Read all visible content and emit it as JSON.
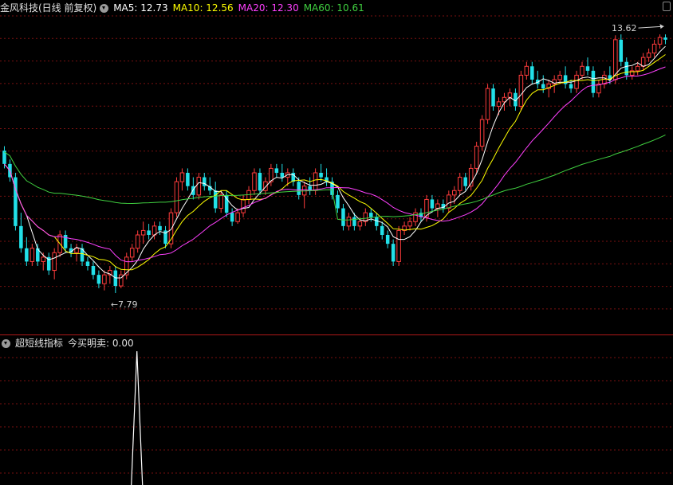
{
  "header": {
    "stock_label": "金风科技(日线 前复权)",
    "ma5": {
      "label": "MA5: 12.73",
      "color": "#ffffff"
    },
    "ma10": {
      "label": "MA10: 12.56",
      "color": "#ffff00"
    },
    "ma20": {
      "label": "MA20: 12.30",
      "color": "#ff40ff"
    },
    "ma60": {
      "label": "MA60: 10.61",
      "color": "#40d040"
    }
  },
  "sub_header": {
    "indicator_label": "超短线指标",
    "value_label": "今买明卖: 0.00"
  },
  "colors": {
    "up": "#ff3c3c",
    "down": "#22e0e8",
    "grid": "#7a1010"
  },
  "chart_data": [
    {
      "type": "candlestick",
      "title": "金风科技(日线 前复权)",
      "ylim": [
        7.0,
        14.0
      ],
      "grid": true,
      "annotations": [
        {
          "text": "13.62",
          "price": 13.62,
          "index": 119
        },
        {
          "text": "←7.79",
          "price": 7.79,
          "index": 20
        }
      ],
      "candles": [
        [
          11.0,
          11.1,
          10.6,
          10.7
        ],
        [
          10.7,
          10.8,
          10.3,
          10.4
        ],
        [
          10.4,
          10.5,
          9.2,
          9.3
        ],
        [
          9.3,
          9.6,
          8.7,
          8.8
        ],
        [
          8.8,
          9.05,
          8.4,
          8.5
        ],
        [
          8.5,
          8.9,
          8.4,
          8.8
        ],
        [
          8.8,
          8.9,
          8.4,
          8.5
        ],
        [
          8.5,
          8.7,
          8.3,
          8.6
        ],
        [
          8.6,
          8.7,
          8.2,
          8.3
        ],
        [
          8.3,
          8.8,
          8.1,
          8.7
        ],
        [
          8.7,
          9.2,
          8.6,
          9.1
        ],
        [
          9.1,
          9.2,
          8.7,
          8.8
        ],
        [
          8.8,
          8.9,
          8.6,
          8.7
        ],
        [
          8.7,
          8.9,
          8.5,
          8.8
        ],
        [
          8.8,
          8.9,
          8.4,
          8.5
        ],
        [
          8.5,
          8.6,
          8.3,
          8.4
        ],
        [
          8.4,
          8.5,
          8.1,
          8.2
        ],
        [
          8.2,
          8.3,
          7.9,
          8.0
        ],
        [
          8.0,
          8.3,
          7.85,
          8.2
        ],
        [
          8.2,
          8.4,
          8.0,
          8.3
        ],
        [
          8.3,
          8.4,
          7.79,
          7.95
        ],
        [
          7.95,
          8.3,
          7.9,
          8.2
        ],
        [
          8.2,
          8.7,
          8.1,
          8.6
        ],
        [
          8.6,
          8.9,
          8.5,
          8.8
        ],
        [
          8.8,
          9.2,
          8.7,
          9.1
        ],
        [
          9.1,
          9.4,
          8.9,
          9.2
        ],
        [
          9.2,
          9.35,
          9.0,
          9.1
        ],
        [
          9.1,
          9.4,
          9.0,
          9.3
        ],
        [
          9.3,
          9.4,
          9.1,
          9.2
        ],
        [
          9.2,
          9.3,
          8.8,
          8.9
        ],
        [
          8.9,
          9.7,
          8.8,
          9.6
        ],
        [
          9.6,
          10.4,
          9.5,
          10.3
        ],
        [
          10.3,
          10.6,
          10.1,
          10.5
        ],
        [
          10.5,
          10.6,
          10.1,
          10.2
        ],
        [
          10.2,
          10.4,
          9.9,
          10.0
        ],
        [
          10.0,
          10.5,
          9.9,
          10.4
        ],
        [
          10.4,
          10.5,
          10.1,
          10.2
        ],
        [
          10.2,
          10.4,
          10.0,
          10.1
        ],
        [
          10.1,
          10.3,
          9.6,
          9.7
        ],
        [
          9.7,
          10.1,
          9.6,
          10.0
        ],
        [
          10.0,
          10.1,
          9.5,
          9.6
        ],
        [
          9.6,
          9.7,
          9.3,
          9.4
        ],
        [
          9.4,
          9.7,
          9.35,
          9.6
        ],
        [
          9.6,
          10.0,
          9.5,
          9.9
        ],
        [
          9.9,
          10.2,
          9.8,
          10.1
        ],
        [
          10.1,
          10.6,
          10.0,
          10.5
        ],
        [
          10.5,
          10.6,
          10.0,
          10.1
        ],
        [
          10.1,
          10.4,
          10.0,
          10.3
        ],
        [
          10.3,
          10.7,
          10.2,
          10.6
        ],
        [
          10.6,
          10.7,
          10.4,
          10.5
        ],
        [
          10.5,
          10.7,
          10.3,
          10.4
        ],
        [
          10.4,
          10.6,
          10.2,
          10.5
        ],
        [
          10.5,
          10.6,
          10.2,
          10.3
        ],
        [
          10.3,
          10.4,
          9.9,
          10.0
        ],
        [
          10.0,
          10.3,
          9.7,
          10.2
        ],
        [
          10.2,
          10.4,
          10.0,
          10.1
        ],
        [
          10.1,
          10.6,
          10.0,
          10.5
        ],
        [
          10.5,
          10.7,
          10.3,
          10.4
        ],
        [
          10.4,
          10.6,
          10.2,
          10.3
        ],
        [
          10.3,
          10.4,
          9.9,
          10.0
        ],
        [
          10.0,
          10.1,
          9.6,
          9.7
        ],
        [
          9.7,
          9.8,
          9.2,
          9.3
        ],
        [
          9.3,
          9.6,
          9.2,
          9.5
        ],
        [
          9.5,
          9.6,
          9.2,
          9.3
        ],
        [
          9.3,
          9.5,
          9.2,
          9.4
        ],
        [
          9.4,
          9.7,
          9.3,
          9.6
        ],
        [
          9.6,
          9.7,
          9.4,
          9.5
        ],
        [
          9.5,
          9.6,
          9.2,
          9.3
        ],
        [
          9.3,
          9.4,
          9.0,
          9.1
        ],
        [
          9.1,
          9.2,
          8.8,
          8.9
        ],
        [
          8.9,
          9.0,
          8.4,
          8.5
        ],
        [
          8.5,
          9.3,
          8.4,
          9.2
        ],
        [
          9.2,
          9.4,
          9.1,
          9.3
        ],
        [
          9.3,
          9.5,
          9.2,
          9.4
        ],
        [
          9.4,
          9.7,
          9.3,
          9.6
        ],
        [
          9.6,
          9.7,
          9.4,
          9.5
        ],
        [
          9.5,
          10.0,
          9.4,
          9.9
        ],
        [
          9.9,
          10.0,
          9.6,
          9.7
        ],
        [
          9.7,
          9.9,
          9.5,
          9.8
        ],
        [
          9.8,
          9.9,
          9.6,
          9.7
        ],
        [
          9.7,
          10.1,
          9.6,
          10.0
        ],
        [
          10.0,
          10.2,
          9.8,
          10.1
        ],
        [
          10.1,
          10.5,
          10.0,
          10.4
        ],
        [
          10.4,
          10.5,
          10.1,
          10.2
        ],
        [
          10.2,
          10.7,
          10.1,
          10.6
        ],
        [
          10.6,
          11.2,
          10.5,
          11.1
        ],
        [
          11.1,
          11.8,
          11.0,
          11.7
        ],
        [
          11.7,
          12.5,
          11.6,
          12.4
        ],
        [
          12.4,
          12.5,
          11.9,
          12.0
        ],
        [
          12.0,
          12.2,
          11.8,
          12.1
        ],
        [
          12.1,
          12.3,
          11.9,
          12.2
        ],
        [
          12.2,
          12.4,
          12.0,
          12.3
        ],
        [
          12.3,
          12.4,
          11.9,
          12.0
        ],
        [
          12.0,
          12.8,
          11.9,
          12.7
        ],
        [
          12.7,
          13.0,
          12.6,
          12.9
        ],
        [
          12.9,
          13.0,
          12.5,
          12.6
        ],
        [
          12.6,
          12.8,
          12.4,
          12.5
        ],
        [
          12.5,
          12.7,
          12.3,
          12.4
        ],
        [
          12.4,
          12.6,
          12.2,
          12.5
        ],
        [
          12.5,
          12.7,
          12.3,
          12.6
        ],
        [
          12.6,
          12.8,
          12.5,
          12.7
        ],
        [
          12.7,
          12.9,
          12.4,
          12.5
        ],
        [
          12.5,
          12.6,
          12.3,
          12.4
        ],
        [
          12.4,
          12.8,
          12.3,
          12.7
        ],
        [
          12.7,
          13.0,
          12.6,
          12.9
        ],
        [
          12.9,
          13.1,
          12.7,
          12.8
        ],
        [
          12.8,
          12.9,
          12.2,
          12.3
        ],
        [
          12.3,
          12.6,
          12.2,
          12.5
        ],
        [
          12.5,
          12.8,
          12.4,
          12.7
        ],
        [
          12.7,
          12.9,
          12.5,
          12.6
        ],
        [
          12.6,
          13.6,
          12.5,
          13.5
        ],
        [
          13.5,
          13.62,
          12.9,
          13.0
        ],
        [
          13.0,
          13.1,
          12.6,
          12.7
        ],
        [
          12.7,
          12.9,
          12.6,
          12.8
        ],
        [
          12.8,
          13.0,
          12.7,
          12.9
        ],
        [
          12.9,
          13.2,
          12.8,
          13.1
        ],
        [
          13.1,
          13.3,
          13.0,
          13.2
        ],
        [
          13.2,
          13.5,
          13.1,
          13.4
        ],
        [
          13.4,
          13.62,
          13.3,
          13.55
        ],
        [
          13.55,
          13.62,
          13.4,
          13.5
        ]
      ],
      "series": [
        {
          "name": "MA5",
          "period": 5
        },
        {
          "name": "MA10",
          "period": 10
        },
        {
          "name": "MA20",
          "period": 20
        },
        {
          "name": "MA60",
          "period": 60
        }
      ]
    },
    {
      "type": "line",
      "title": "超短线指标",
      "ylim": [
        0,
        1
      ],
      "spike_index": 23,
      "values_note": ""
    }
  ]
}
